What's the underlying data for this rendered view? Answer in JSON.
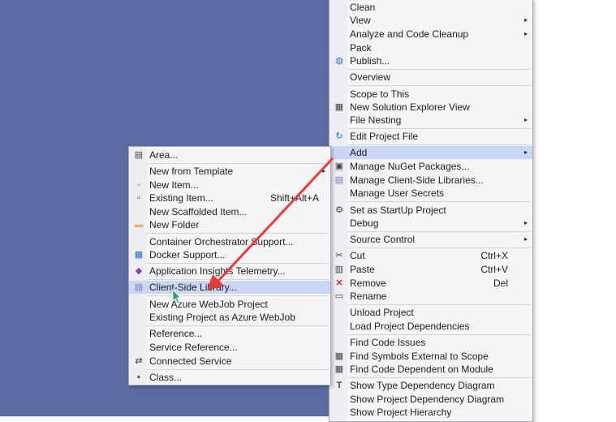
{
  "context_menu": {
    "items": [
      {
        "label": "Clean"
      },
      {
        "label": "View",
        "arrow": "▸"
      },
      {
        "label": "Analyze and Code Cleanup",
        "arrow": "▸"
      },
      {
        "label": "Pack"
      },
      {
        "label": "Publish..."
      },
      {
        "label": "Overview"
      },
      {
        "label": "Scope to This"
      },
      {
        "label": "New Solution Explorer View"
      },
      {
        "label": "File Nesting",
        "arrow": "▸"
      },
      {
        "label": "Edit Project File"
      },
      {
        "label": "Add",
        "arrow": "▸"
      },
      {
        "label": "Manage NuGet Packages..."
      },
      {
        "label": "Manage Client-Side Libraries..."
      },
      {
        "label": "Manage User Secrets"
      },
      {
        "label": "Set as StartUp Project"
      },
      {
        "label": "Debug",
        "arrow": "▸"
      },
      {
        "label": "Source Control",
        "arrow": "▸"
      },
      {
        "label": "Cut",
        "shortcut": "Ctrl+X"
      },
      {
        "label": "Paste",
        "shortcut": "Ctrl+V"
      },
      {
        "label": "Remove",
        "shortcut": "Del"
      },
      {
        "label": "Rename"
      },
      {
        "label": "Unload Project"
      },
      {
        "label": "Load Project Dependencies"
      },
      {
        "label": "Find Code Issues"
      },
      {
        "label": "Find Symbols External to Scope"
      },
      {
        "label": "Find Code Dependent on Module"
      },
      {
        "label": "Show Type Dependency Diagram"
      },
      {
        "label": "Show Project Dependency Diagram"
      },
      {
        "label": "Show Project Hierarchy"
      }
    ]
  },
  "add_submenu": {
    "items": [
      {
        "label": "Area..."
      },
      {
        "label": "New from Template",
        "arrow": "▸"
      },
      {
        "label": "New Item..."
      },
      {
        "label": "Existing Item...",
        "shortcut": "Shift+Alt+A"
      },
      {
        "label": "New Scaffolded Item..."
      },
      {
        "label": "New Folder"
      },
      {
        "label": "Container Orchestrator Support..."
      },
      {
        "label": "Docker Support..."
      },
      {
        "label": "Application Insights Telemetry..."
      },
      {
        "label": "Client-Side Library..."
      },
      {
        "label": "New Azure WebJob Project"
      },
      {
        "label": "Existing Project as Azure WebJob"
      },
      {
        "label": "Reference..."
      },
      {
        "label": "Service Reference..."
      },
      {
        "label": "Connected Service"
      },
      {
        "label": "Class..."
      }
    ]
  },
  "icons": {
    "publish": "◍",
    "solution-explorer": "▦",
    "edit-project": "↻",
    "nuget": "▣",
    "client-side-lib": "▤",
    "startup": "⚙",
    "cut": "✂",
    "paste": "▥",
    "remove": "✕",
    "rename": "▭",
    "find-symbols": "▦",
    "find-code": "▦",
    "type-diagram": "T",
    "area": "▤",
    "new-item": "▫",
    "existing-item": "▫",
    "new-folder": "▬",
    "docker": "▦",
    "app-insights": "◆",
    "client-lib-sub": "▤",
    "connected-service": "⇄",
    "class": "▪"
  },
  "colors": {
    "highlight": "#c9d7f5",
    "desktop": "#5c6ba1",
    "arrow": "#e83b3b"
  }
}
